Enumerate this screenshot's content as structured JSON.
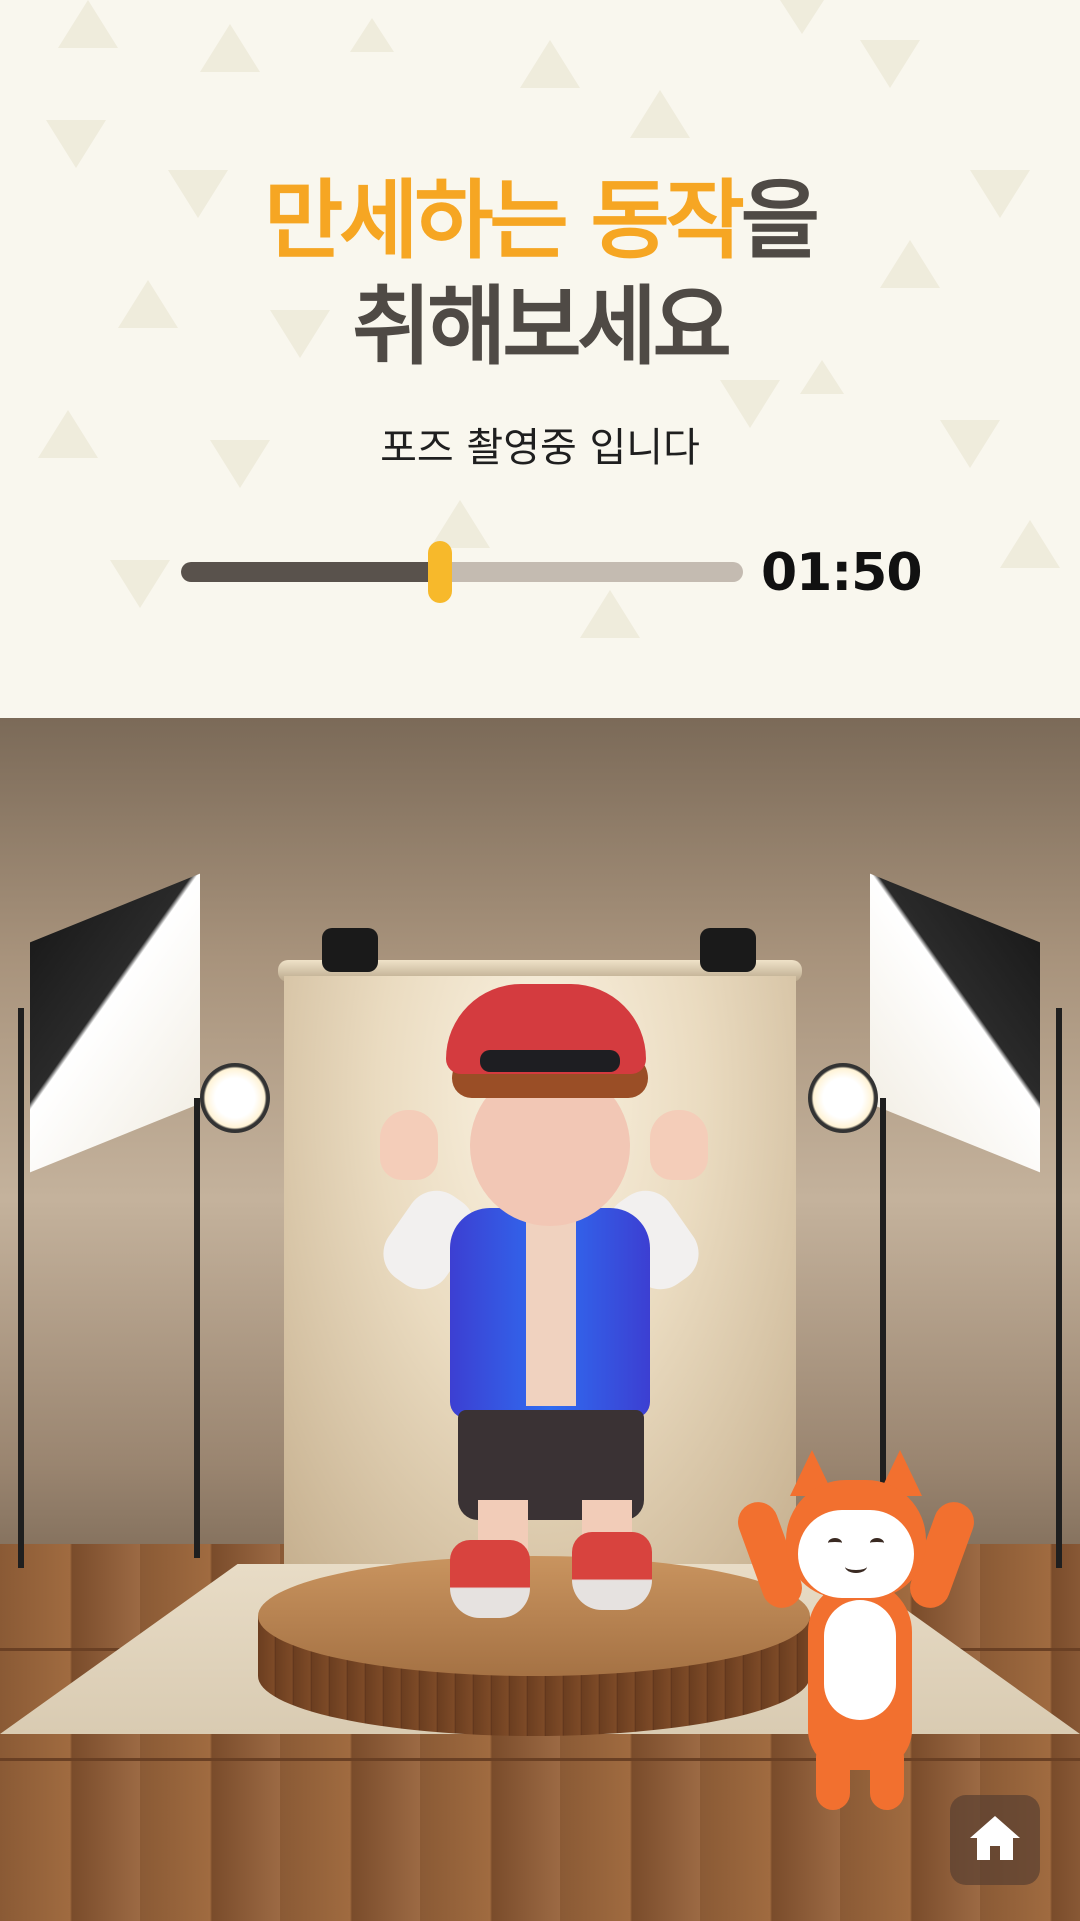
{
  "instruction": {
    "line1_highlight": "만세하는 동작",
    "line1_rest": "을",
    "line2": "취해보세요",
    "highlight_color": "#f6a623",
    "text_color": "#4f4a45"
  },
  "status": {
    "subtitle": "포즈 촬영중 입니다"
  },
  "timer": {
    "progress": 0.46,
    "time_text": "01:50",
    "fill_color": "#59524c",
    "track_color": "#c4bbb1",
    "thumb_color": "#f7b92b"
  },
  "scene": {
    "avatar_icon": "boy-avatar",
    "mascot_icon": "fox-mascot"
  },
  "navigation": {
    "home_icon": "home-icon"
  }
}
